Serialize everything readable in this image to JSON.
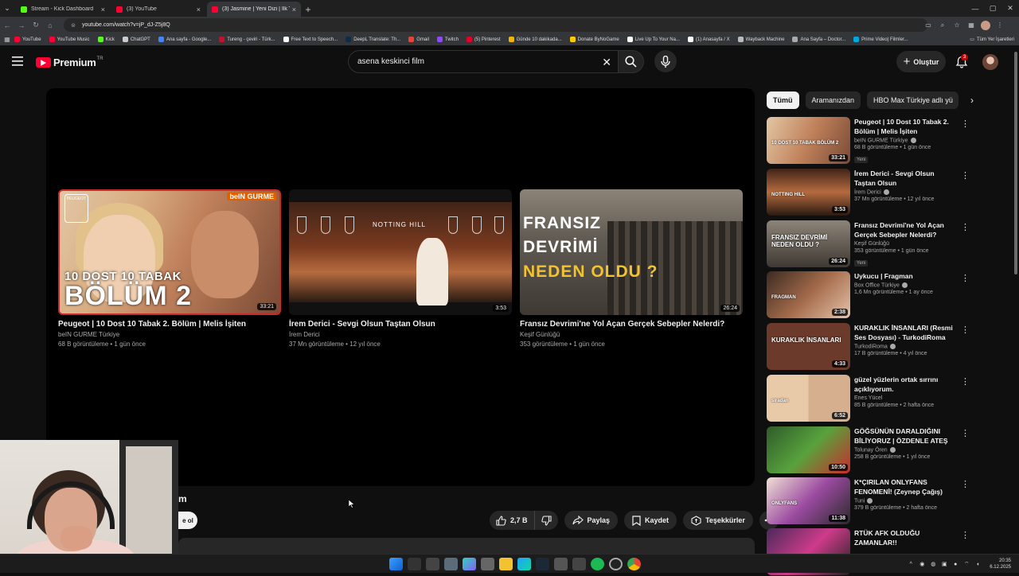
{
  "browser": {
    "tabs": [
      {
        "title": "Stream - Kick Dashboard",
        "color": "#53fc18",
        "active": false
      },
      {
        "title": "(3) YouTube",
        "color": "#ff0033",
        "active": false
      },
      {
        "title": "(3) Jasmine | Yeni Dizi | İlk T",
        "color": "#ff0033",
        "active": true
      }
    ],
    "url": "youtube.com/watch?v=jP_dJ-Z5j8Q",
    "bookmarks": [
      {
        "label": "YouTube",
        "color": "#ff0033"
      },
      {
        "label": "YouTube Music",
        "color": "#ff0033"
      },
      {
        "label": "Kick",
        "color": "#53fc18"
      },
      {
        "label": "ChatGPT",
        "color": "#cccccc"
      },
      {
        "label": "Ana sayfa - Google...",
        "color": "#4285f4"
      },
      {
        "label": "Tureng - çeviri - Türk...",
        "color": "#c8102e"
      },
      {
        "label": "Free Text to Speech...",
        "color": "#ffffff"
      },
      {
        "label": "DeepL Translate: Th...",
        "color": "#0f2b46"
      },
      {
        "label": "Gmail",
        "color": "#ea4335"
      },
      {
        "label": "Twitch",
        "color": "#9146ff"
      },
      {
        "label": "(5) Pinterest",
        "color": "#e60023"
      },
      {
        "label": "Günde 10 dakikada...",
        "color": "#f4b400"
      },
      {
        "label": "Donate ByNoGame",
        "color": "#ffcc00"
      },
      {
        "label": "Live Up To Your Na...",
        "color": "#ffffff"
      },
      {
        "label": "(1) Anasayfa / X",
        "color": "#ffffff"
      },
      {
        "label": "Wayback Machine",
        "color": "#bbbbbb"
      },
      {
        "label": "Ana Sayfa – Doctor...",
        "color": "#aaaaaa"
      },
      {
        "label": "Prime Video| Filmler...",
        "color": "#00a8e1"
      }
    ],
    "bookmarks_all": "Tüm Yer İşaretleri"
  },
  "header": {
    "brand": "Premium",
    "region": "TR",
    "search_value": "asena keskinci film",
    "create_label": "Oluştur",
    "notif_count": "3"
  },
  "end_screen": [
    {
      "title": "Peugeot | 10 Dost 10 Tabak 2. Bölüm | Melis İşiten",
      "channel": "beIN GURME Türkiye",
      "meta": "68 B görüntüleme • 1 gün önce",
      "duration": "33:21",
      "thumb_line1": "10 DOST 10 TABAK",
      "thumb_line2": "BÖLÜM 2",
      "thumb_brand": "beIN GURME",
      "thumb_logo": "PEUGEOT"
    },
    {
      "title": "İrem Derici - Sevgi Olsun Taştan Olsun",
      "channel": "İrem Derici",
      "meta": "37 Mn görüntüleme • 12 yıl önce",
      "duration": "3:53",
      "thumb_sign": "NOTTING HILL"
    },
    {
      "title": "Fransız Devrimi'ne Yol Açan Gerçek Sebepler Nelerdi?",
      "channel": "Keşif Günlüğü",
      "meta": "353 görüntüleme • 1 gün önce",
      "duration": "26:24",
      "thumb_line1": "FRANSIZ",
      "thumb_line2": "DEVRİMİ",
      "thumb_line3": "NEDEN OLDU ?"
    }
  ],
  "below_player": {
    "channel_fragment": "m",
    "subscribe_fragment": "e ol",
    "like_count": "2,7 B",
    "share_label": "Paylaş",
    "save_label": "Kaydet",
    "thanks_label": "Teşekkürler"
  },
  "chips": [
    "Tümü",
    "Aramanızdan",
    "HBO Max Türkiye adlı yü"
  ],
  "recommendations": [
    {
      "title": "Peugeot | 10 Dost 10 Tabak 2. Bölüm | Melis İşiten",
      "channel": "beIN GURME Türkiye",
      "meta": "68 B görüntüleme • 1 gün önce",
      "duration": "33:21",
      "badge": "Yeni",
      "thumb_text": "10 DOST 10 TABAK BÖLÜM 2"
    },
    {
      "title": "İrem Derici - Sevgi Olsun Taştan Olsun",
      "channel": "İrem Derici",
      "meta": "37 Mn görüntüleme • 12 yıl önce",
      "duration": "3:53",
      "badge": "",
      "thumb_text": "NOTTING HILL"
    },
    {
      "title": "Fransız Devrimi'ne Yol Açan Gerçek Sebepler Nelerdi?",
      "channel": "Keşif Günlüğü",
      "meta": "353 görüntüleme • 1 gün önce",
      "duration": "26:24",
      "badge": "Yeni",
      "thumb_text": "FRANSIZ DEVRİMİ NEDEN OLDU ?"
    },
    {
      "title": "Uykucu | Fragman",
      "channel": "Box Office Türkiye",
      "meta": "1,6 Mn görüntüleme • 1 ay önce",
      "duration": "2:38",
      "badge": "",
      "thumb_text": "FRAGMAN"
    },
    {
      "title": "KURAKLIK İNSANLARI (Resmi Ses Dosyası) - TurkodiRoma",
      "channel": "TurkodiRoma",
      "meta": "17 B görüntüleme • 4 yıl önce",
      "duration": "4:33",
      "badge": "",
      "thumb_text": "KURAKLIK İNSANLARI"
    },
    {
      "title": "güzel yüzlerin ortak sırrını açıklıyorum.",
      "channel": "Enes Yücel",
      "meta": "85 B görüntüleme • 2 hafta önce",
      "duration": "6:52",
      "badge": "",
      "thumb_text": "sıradan"
    },
    {
      "title": "GÖĞSÜNÜN DARALDIĞINI BİLİYORUZ | ÖZDENLE ATEŞ V...",
      "channel": "Tolunay Ören",
      "meta": "258 B görüntüleme • 1 yıl önce",
      "duration": "10:50",
      "badge": "",
      "thumb_text": ""
    },
    {
      "title": "K*ÇIRILAN ONLYFANS FENOMENİ! (Zeynep Çağış)",
      "channel": "Tuni",
      "meta": "379 B görüntüleme • 2 hafta önce",
      "duration": "11:38",
      "badge": "",
      "thumb_text": "ONLYFANS"
    },
    {
      "title": "RTÜK AFK OLDUĞU ZAMANLAR!!",
      "channel": "",
      "meta": "",
      "duration": "",
      "badge": "",
      "thumb_text": ""
    }
  ],
  "taskbar": {
    "time": "20:35",
    "date": "6.12.2025"
  }
}
